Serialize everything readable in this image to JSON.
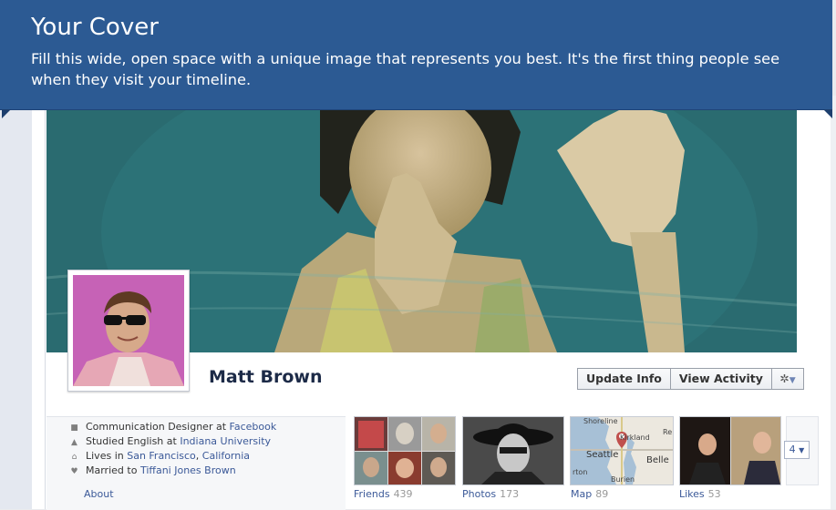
{
  "tooltip": {
    "title": "Your Cover",
    "body": "Fill this wide, open space with a unique image that represents you best. It's the first thing people see when they visit your timeline."
  },
  "profile": {
    "name": "Matt Brown"
  },
  "actions": {
    "update_info": "Update Info",
    "view_activity": "View Activity",
    "gear_icon": "gear-icon"
  },
  "about": {
    "items": [
      {
        "icon": "briefcase-icon",
        "prefix": "Communication Designer at ",
        "link": "Facebook",
        "suffix": "",
        "link2": ""
      },
      {
        "icon": "graduation-cap-icon",
        "prefix": "Studied English at ",
        "link": "Indiana University",
        "suffix": "",
        "link2": ""
      },
      {
        "icon": "house-icon",
        "prefix": "Lives in ",
        "link": "San Francisco",
        "suffix": ", ",
        "link2": "California"
      },
      {
        "icon": "heart-icon",
        "prefix": "Married to ",
        "link": "Tiffani Jones Brown",
        "suffix": "",
        "link2": ""
      }
    ]
  },
  "tabs": {
    "about": {
      "label": "About"
    },
    "friends": {
      "label": "Friends",
      "count": "439"
    },
    "photos": {
      "label": "Photos",
      "count": "173"
    },
    "map": {
      "label": "Map",
      "count": "89",
      "places": [
        "Shoreline",
        "Kirkland",
        "Re",
        "Seattle",
        "Belle",
        "rton",
        "Burien"
      ]
    },
    "likes": {
      "label": "Likes",
      "count": "53"
    },
    "more": {
      "label": "4"
    }
  },
  "colors": {
    "banner": "#2c5a93",
    "link": "#3b5998",
    "name": "#1c2a47"
  }
}
